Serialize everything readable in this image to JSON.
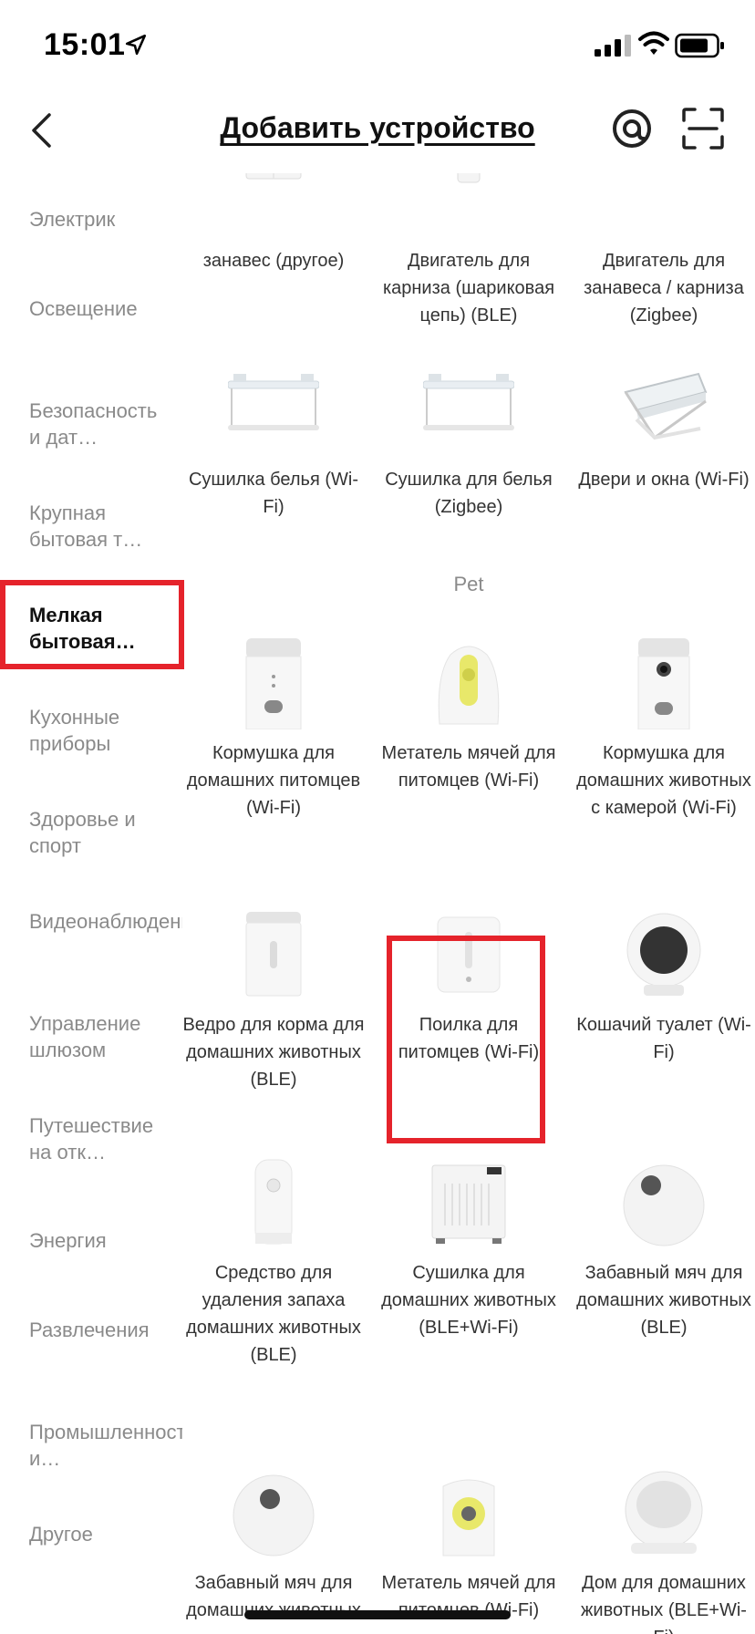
{
  "status": {
    "time": "15:01"
  },
  "nav": {
    "title": "Добавить устройство"
  },
  "sidebar": {
    "items": [
      {
        "label": "Электрик"
      },
      {
        "label": "Освещение"
      },
      {
        "label": "Безопасность и дат…"
      },
      {
        "label": "Крупная бытовая т…"
      },
      {
        "label": "Мелкая бытовая…"
      },
      {
        "label": "Кухонные приборы"
      },
      {
        "label": "Здоровье и спорт"
      },
      {
        "label": "Видеонаблюдение"
      },
      {
        "label": "Управление шлюзом"
      },
      {
        "label": "Путешествие на отк…"
      },
      {
        "label": "Энергия"
      },
      {
        "label": "Развлечения"
      },
      {
        "label": "Промышленность и…"
      },
      {
        "label": "Другое"
      }
    ]
  },
  "content": {
    "top_row": [
      {
        "label": "занавес\n(другое)"
      },
      {
        "label": "Двигатель для карниза (шариковая цепь) (BLE)"
      },
      {
        "label": "Двигатель для занавеса / карниза (Zigbee)"
      }
    ],
    "row2": [
      {
        "label": "Сушилка белья (Wi-Fi)"
      },
      {
        "label": "Сушилка для белья (Zigbee)"
      },
      {
        "label": "Двери и окна (Wi-Fi)"
      }
    ],
    "section_title": "Pet",
    "pet": [
      {
        "label": "Кормушка для домашних питомцев (Wi-Fi)"
      },
      {
        "label": "Метатель мячей для питомцев (Wi-Fi)"
      },
      {
        "label": "Кормушка для домашних животных с камерой (Wi-Fi)"
      },
      {
        "label": "Ведро для корма для домашних животных (BLE)"
      },
      {
        "label": "Поилка для питомцев (Wi-Fi)"
      },
      {
        "label": "Кошачий туалет (Wi-Fi)"
      },
      {
        "label": "Средство для удаления запаха домашних животных (BLE)"
      },
      {
        "label": "Сушилка для домашних животных (BLE+Wi-Fi)"
      },
      {
        "label": "Забавный мяч для домашних животных (BLE)"
      },
      {
        "label": "Забавный мяч для домашних животных"
      },
      {
        "label": "Метатель мячей для питомцев (Wi-Fi)"
      },
      {
        "label": "Дом для домашних животных (BLE+Wi-Fi)"
      }
    ]
  },
  "colors": {
    "highlight": "#e5232b",
    "accent_yellow": "#e8e86a"
  }
}
